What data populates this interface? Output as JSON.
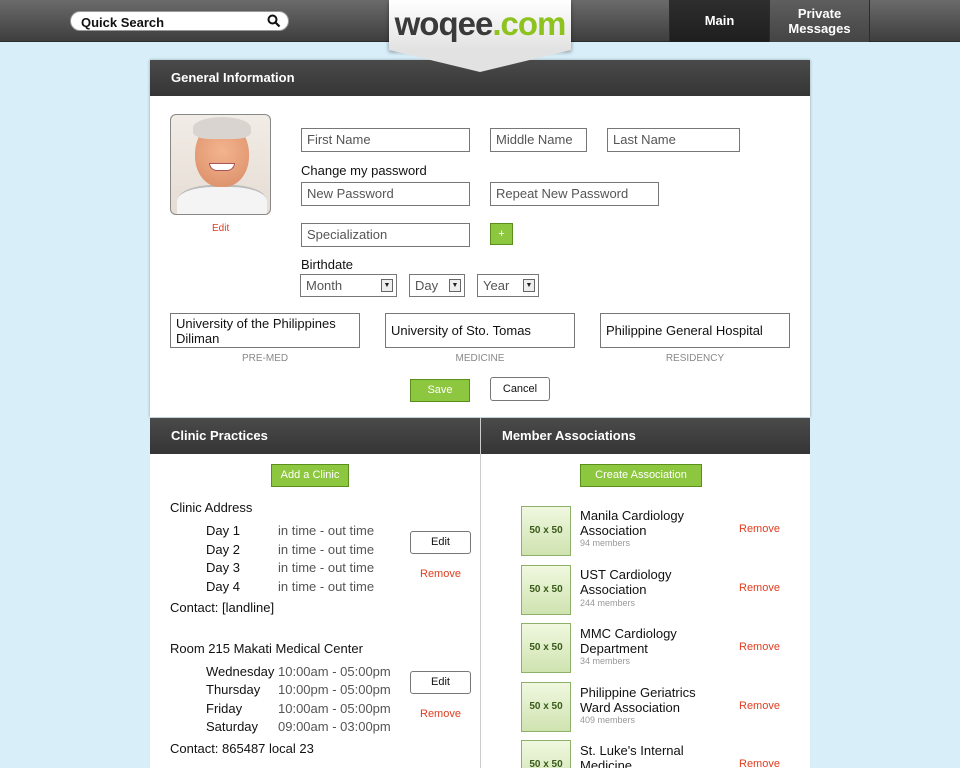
{
  "header": {
    "search_label": "Quick Search",
    "logo_main": "woqee",
    "logo_accent": ".com",
    "nav_main": "Main",
    "nav_pm_line1": "Private",
    "nav_pm_line2": "Messages"
  },
  "general": {
    "title": "General Information",
    "avatar_edit": "Edit",
    "first_name_placeholder": "First Name",
    "middle_name_placeholder": "Middle Name",
    "last_name_placeholder": "Last Name",
    "change_password_label": "Change my password",
    "new_password_placeholder": "New Password",
    "repeat_password_placeholder": "Repeat New Password",
    "specialization_placeholder": "Specialization",
    "plus_label": "+",
    "birthdate_label": "Birthdate",
    "month": "Month",
    "day": "Day",
    "year": "Year",
    "schools": [
      {
        "name_line1": "University of the Philippines",
        "name_line2": "Diliman",
        "label": "PRE-MED"
      },
      {
        "name": "University of Sto. Tomas",
        "label": "MEDICINE"
      },
      {
        "name": "Philippine General Hospital",
        "label": "RESIDENCY"
      }
    ],
    "save_label": "Save",
    "cancel_label": "Cancel"
  },
  "clinics": {
    "title": "Clinic Practices",
    "add_label": "Add a Clinic",
    "items": [
      {
        "address": "Clinic Address",
        "schedule": [
          {
            "day": "Day 1",
            "time": "in time - out time"
          },
          {
            "day": "Day 2",
            "time": "in time - out time"
          },
          {
            "day": "Day 3",
            "time": "in time - out time"
          },
          {
            "day": "Day 4",
            "time": "in time - out time"
          }
        ],
        "contact": "Contact: [landline]",
        "edit_label": "Edit",
        "remove_label": "Remove"
      },
      {
        "address": "Room 215 Makati Medical Center",
        "schedule": [
          {
            "day": "Wednesday",
            "time": "10:00am - 05:00pm"
          },
          {
            "day": "Thursday",
            "time": "10:00pm - 05:00pm"
          },
          {
            "day": "Friday",
            "time": "10:00am - 05:00pm"
          },
          {
            "day": "Saturday",
            "time": "09:00am - 03:00pm"
          }
        ],
        "contact": "Contact: 865487 local 23",
        "edit_label": "Edit",
        "remove_label": "Remove"
      }
    ]
  },
  "associations": {
    "title": "Member Associations",
    "create_label": "Create Association",
    "thumb_label": "50 x 50",
    "items": [
      {
        "name_line1": "Manila Cardiology",
        "name_line2": "Association",
        "members": "94 members",
        "remove": "Remove"
      },
      {
        "name_line1": "UST Cardiology",
        "name_line2": "Association",
        "members": "244 members",
        "remove": "Remove"
      },
      {
        "name_line1": "MMC Cardiology",
        "name_line2": "Department",
        "members": "34 members",
        "remove": "Remove"
      },
      {
        "name_line1": "Philippine Geriatrics",
        "name_line2": "Ward Association",
        "members": "409 members",
        "remove": "Remove"
      },
      {
        "name_line1": "St. Luke's Internal",
        "name_line2": "Medicine",
        "members": "",
        "remove": "Remove"
      }
    ]
  }
}
